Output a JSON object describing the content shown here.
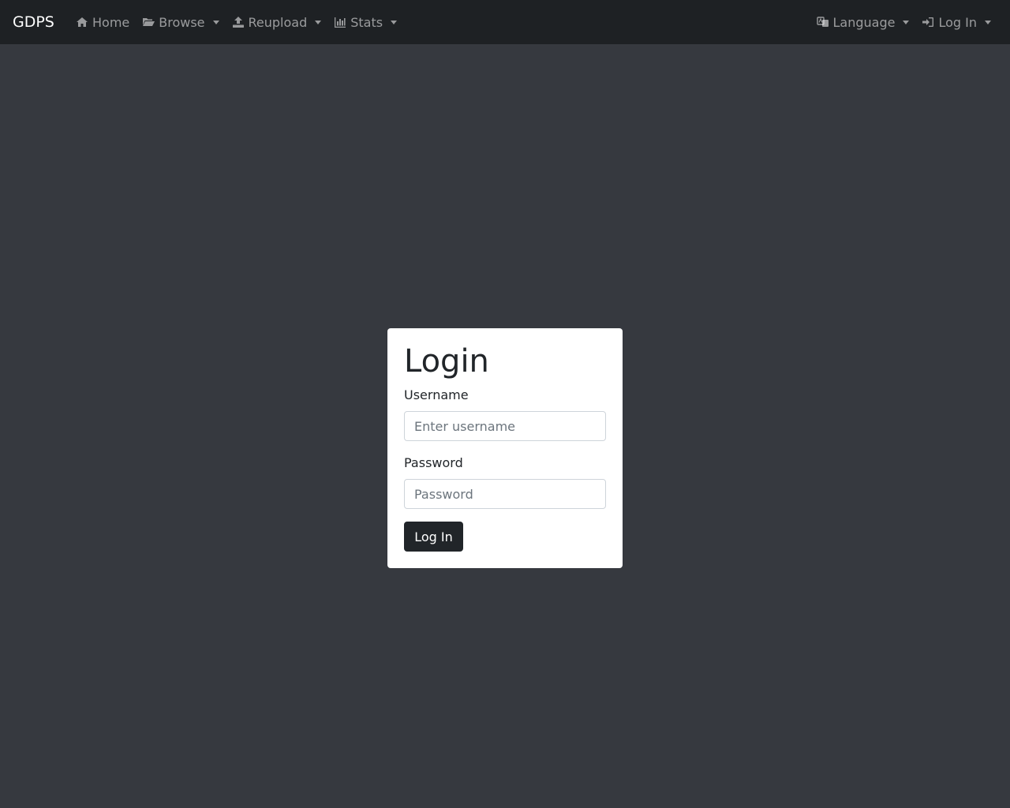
{
  "navbar": {
    "brand": "GDPS",
    "left_items": [
      {
        "label": "Home",
        "icon": "home-icon",
        "dropdown": false
      },
      {
        "label": "Browse",
        "icon": "folder-open-icon",
        "dropdown": true
      },
      {
        "label": "Reupload",
        "icon": "upload-icon",
        "dropdown": true
      },
      {
        "label": "Stats",
        "icon": "bar-chart-icon",
        "dropdown": true
      }
    ],
    "right_items": [
      {
        "label": "Language",
        "icon": "language-icon",
        "dropdown": true
      },
      {
        "label": "Log In",
        "icon": "sign-in-icon",
        "dropdown": true
      }
    ]
  },
  "login": {
    "title": "Login",
    "username_label": "Username",
    "username_placeholder": "Enter username",
    "password_label": "Password",
    "password_placeholder": "Password",
    "submit_label": "Log In"
  },
  "colors": {
    "page_background": "#36393f",
    "navbar_background": "#1e2124",
    "card_background": "#ffffff",
    "button_background": "#212529"
  }
}
